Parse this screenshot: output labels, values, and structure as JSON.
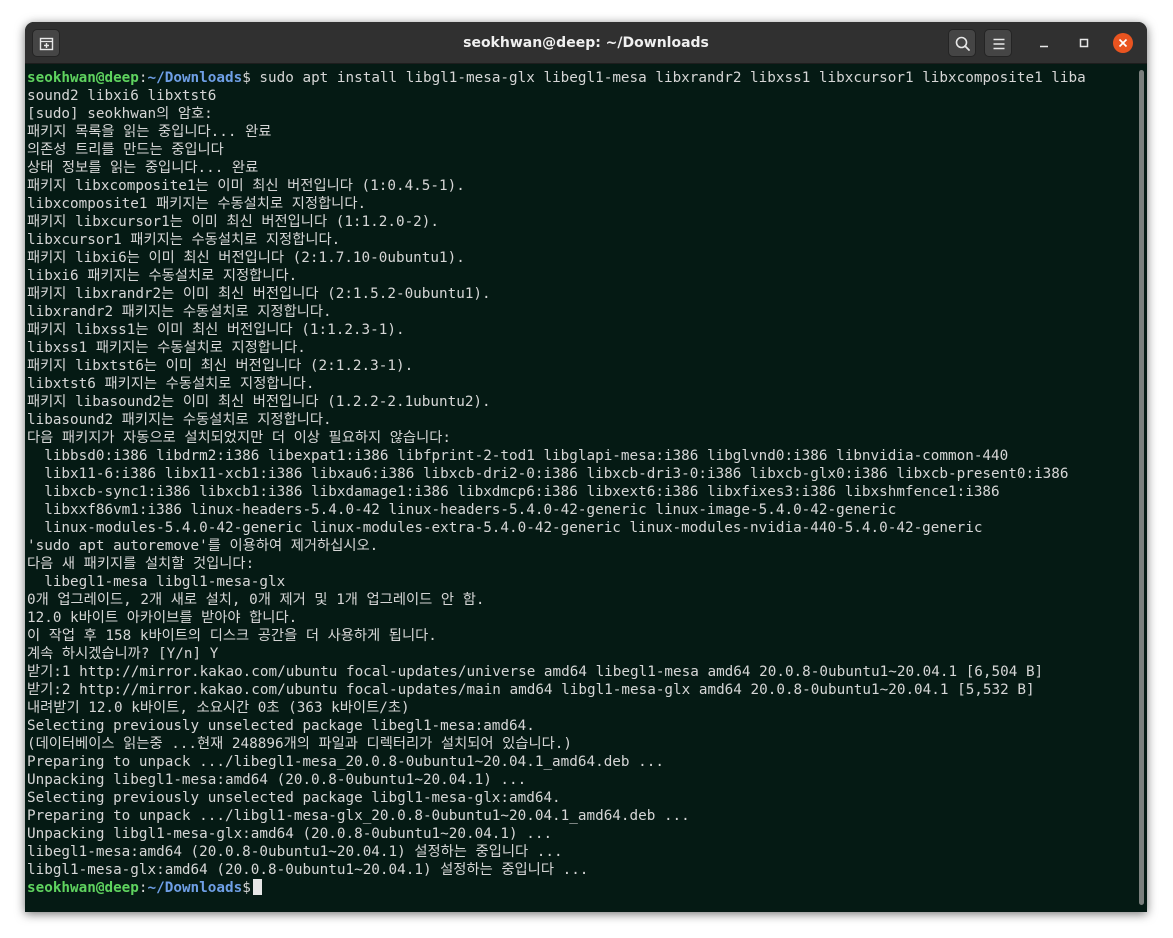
{
  "window": {
    "title": "seokhwan@deep: ~/Downloads"
  },
  "titlebar": {
    "icons": {
      "new_tab": "new-tab-icon",
      "search": "search-icon",
      "menu": "hamburger-menu-icon",
      "minimize": "minimize-icon",
      "maximize": "maximize-icon",
      "close": "close-icon"
    }
  },
  "colors": {
    "terminal_bg": "#051a14",
    "titlebar_bg": "#303030",
    "prompt_user": "#5fd35f",
    "prompt_path": "#6f9fe6",
    "close_button": "#e95420",
    "text": "#d6d6d6"
  },
  "prompt": {
    "user_host": "seokhwan@deep",
    "separator": ":",
    "path": "~/Downloads",
    "symbol": "$"
  },
  "command": " sudo apt install libgl1-mesa-glx libegl1-mesa libxrandr2 libxss1 libxcursor1 libxcomposite1 liba",
  "output": [
    "sound2 libxi6 libxtst6",
    "[sudo] seokhwan의 암호:",
    "패키지 목록을 읽는 중입니다... 완료",
    "의존성 트리를 만드는 중입니다",
    "상태 정보를 읽는 중입니다... 완료",
    "패키지 libxcomposite1는 이미 최신 버전입니다 (1:0.4.5-1).",
    "libxcomposite1 패키지는 수동설치로 지정합니다.",
    "패키지 libxcursor1는 이미 최신 버전입니다 (1:1.2.0-2).",
    "libxcursor1 패키지는 수동설치로 지정합니다.",
    "패키지 libxi6는 이미 최신 버전입니다 (2:1.7.10-0ubuntu1).",
    "libxi6 패키지는 수동설치로 지정합니다.",
    "패키지 libxrandr2는 이미 최신 버전입니다 (2:1.5.2-0ubuntu1).",
    "libxrandr2 패키지는 수동설치로 지정합니다.",
    "패키지 libxss1는 이미 최신 버전입니다 (1:1.2.3-1).",
    "libxss1 패키지는 수동설치로 지정합니다.",
    "패키지 libxtst6는 이미 최신 버전입니다 (2:1.2.3-1).",
    "libxtst6 패키지는 수동설치로 지정합니다.",
    "패키지 libasound2는 이미 최신 버전입니다 (1.2.2-2.1ubuntu2).",
    "libasound2 패키지는 수동설치로 지정합니다.",
    "다음 패키지가 자동으로 설치되었지만 더 이상 필요하지 않습니다:",
    "  libbsd0:i386 libdrm2:i386 libexpat1:i386 libfprint-2-tod1 libglapi-mesa:i386 libglvnd0:i386 libnvidia-common-440",
    "  libx11-6:i386 libx11-xcb1:i386 libxau6:i386 libxcb-dri2-0:i386 libxcb-dri3-0:i386 libxcb-glx0:i386 libxcb-present0:i386",
    "  libxcb-sync1:i386 libxcb1:i386 libxdamage1:i386 libxdmcp6:i386 libxext6:i386 libxfixes3:i386 libxshmfence1:i386",
    "  libxxf86vm1:i386 linux-headers-5.4.0-42 linux-headers-5.4.0-42-generic linux-image-5.4.0-42-generic",
    "  linux-modules-5.4.0-42-generic linux-modules-extra-5.4.0-42-generic linux-modules-nvidia-440-5.4.0-42-generic",
    "'sudo apt autoremove'를 이용하여 제거하십시오.",
    "다음 새 패키지를 설치할 것입니다:",
    "  libegl1-mesa libgl1-mesa-glx",
    "0개 업그레이드, 2개 새로 설치, 0개 제거 및 1개 업그레이드 안 함.",
    "12.0 k바이트 아카이브를 받아야 합니다.",
    "이 작업 후 158 k바이트의 디스크 공간을 더 사용하게 됩니다.",
    "계속 하시겠습니까? [Y/n] Y",
    "받기:1 http://mirror.kakao.com/ubuntu focal-updates/universe amd64 libegl1-mesa amd64 20.0.8-0ubuntu1~20.04.1 [6,504 B]",
    "받기:2 http://mirror.kakao.com/ubuntu focal-updates/main amd64 libgl1-mesa-glx amd64 20.0.8-0ubuntu1~20.04.1 [5,532 B]",
    "내려받기 12.0 k바이트, 소요시간 0초 (363 k바이트/초)",
    "Selecting previously unselected package libegl1-mesa:amd64.",
    "(데이터베이스 읽는중 ...현재 248896개의 파일과 디렉터리가 설치되어 있습니다.)",
    "Preparing to unpack .../libegl1-mesa_20.0.8-0ubuntu1~20.04.1_amd64.deb ...",
    "Unpacking libegl1-mesa:amd64 (20.0.8-0ubuntu1~20.04.1) ...",
    "Selecting previously unselected package libgl1-mesa-glx:amd64.",
    "Preparing to unpack .../libgl1-mesa-glx_20.0.8-0ubuntu1~20.04.1_amd64.deb ...",
    "Unpacking libgl1-mesa-glx:amd64 (20.0.8-0ubuntu1~20.04.1) ...",
    "libegl1-mesa:amd64 (20.0.8-0ubuntu1~20.04.1) 설정하는 중입니다 ...",
    "libgl1-mesa-glx:amd64 (20.0.8-0ubuntu1~20.04.1) 설정하는 중입니다 ..."
  ]
}
